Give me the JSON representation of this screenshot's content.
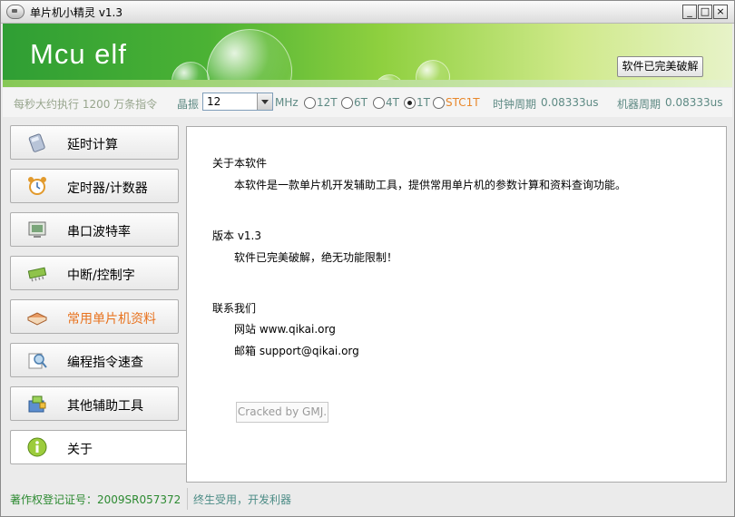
{
  "window": {
    "title": "单片机小精灵  v1.3",
    "minimize_glyph": "_",
    "maximize_glyph": "□",
    "close_glyph": "×"
  },
  "banner": {
    "logo_text": "Mcu elf",
    "crack_button": "软件已完美破解"
  },
  "infobar": {
    "performance_text": "每秒大约执行 1200 万条指令",
    "crystal_label": "晶振",
    "crystal_value": "12",
    "crystal_unit": "MHz",
    "modes": [
      {
        "label": "12T",
        "selected": false
      },
      {
        "label": "6T",
        "selected": false
      },
      {
        "label": "4T",
        "selected": false
      },
      {
        "label": "1T",
        "selected": true
      },
      {
        "label": "STC1T",
        "selected": false
      }
    ],
    "clock_cycle_label": "时钟周期",
    "clock_cycle_value": "0.08333us",
    "machine_cycle_label": "机器周期",
    "machine_cycle_value": "0.08333us"
  },
  "sidebar": {
    "items": [
      {
        "label": "延时计算",
        "icon": "calculator-icon"
      },
      {
        "label": "定时器/计数器",
        "icon": "alarm-clock-icon"
      },
      {
        "label": "串口波特率",
        "icon": "monitor-icon"
      },
      {
        "label": "中断/控制字",
        "icon": "chip-icon"
      },
      {
        "label": "常用单片机资料",
        "icon": "book-icon"
      },
      {
        "label": "编程指令速查",
        "icon": "magnifier-icon"
      },
      {
        "label": "其他辅助工具",
        "icon": "toolbox-icon"
      },
      {
        "label": "关于",
        "icon": "info-icon"
      }
    ]
  },
  "content": {
    "about_title": "关于本软件",
    "about_text": "本软件是一款单片机开发辅助工具，提供常用单片机的参数计算和资料查询功能。",
    "version_title": "版本  v1.3",
    "version_text": "软件已完美破解，绝无功能限制！",
    "contact_title": "联系我们",
    "website": "网站 www.qikai.org",
    "email": "邮箱 support@qikai.org",
    "cracked_button": "Cracked by GMJ."
  },
  "status": {
    "copyright": "著作权登记证号：2009SR057372",
    "slogan": "终生受用，开发利器"
  },
  "colors": {
    "banner_green": "#4bb234",
    "accent_orange": "#e8731f",
    "status_green": "#2c8a31"
  }
}
